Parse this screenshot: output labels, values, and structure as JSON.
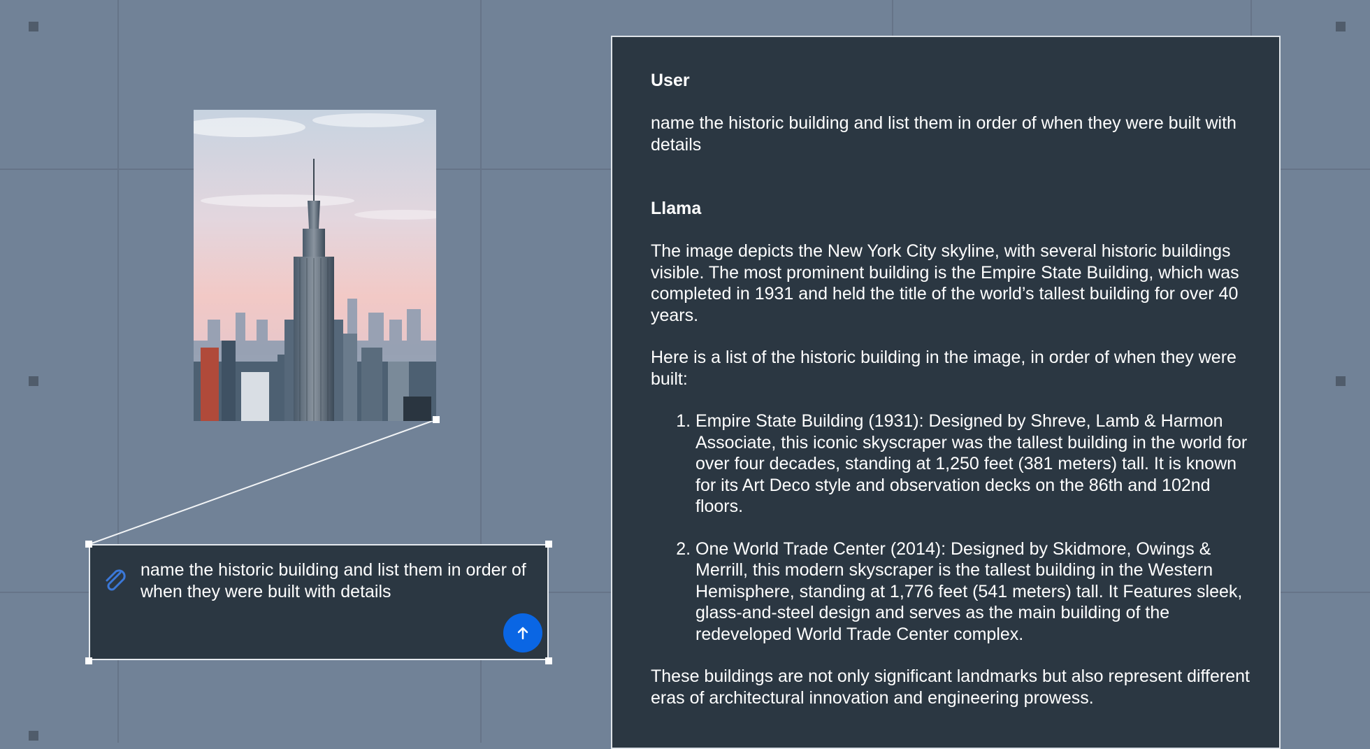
{
  "colors": {
    "background": "#718297",
    "panel": "#2b3742",
    "accent": "#0a66e4",
    "text": "#ffffff"
  },
  "prompt_card": {
    "attach_icon": "paperclip-icon",
    "text": "name the historic building and list them in order of when they were built with details",
    "send_icon": "arrow-up-icon"
  },
  "image": {
    "icon": "empire-state-building-photo"
  },
  "chat": {
    "user_label": "User",
    "user_message": "name the historic building and list them in order of when they were built with details",
    "assistant_label": "Llama",
    "intro": "The image depicts the New York City skyline, with several historic buildings visible. The most prominent building is the Empire State Building, which was completed in 1931 and held the title of the world’s tallest building for over 40 years.",
    "list_intro": "Here is a list of the historic building in the image, in order of when they were built:",
    "items": [
      "Empire State Building (1931): Designed by Shreve, Lamb & Harmon Associate, this iconic skyscraper was the tallest building in the world for over four decades, standing at 1,250 feet (381 meters) tall. It is known for its Art Deco style and observation decks on the 86th and 102nd floors.",
      "One World Trade Center (2014): Designed by Skidmore, Owings & Merrill, this modern skyscraper is the tallest building in the Western Hemisphere, standing at 1,776 feet (541 meters) tall. It Features sleek, glass-and-steel design and serves as the main building of the redeveloped World Trade Center complex."
    ],
    "conclusion": "These buildings are not only significant landmarks but also represent different eras of architectural innovation and engineering prowess."
  }
}
